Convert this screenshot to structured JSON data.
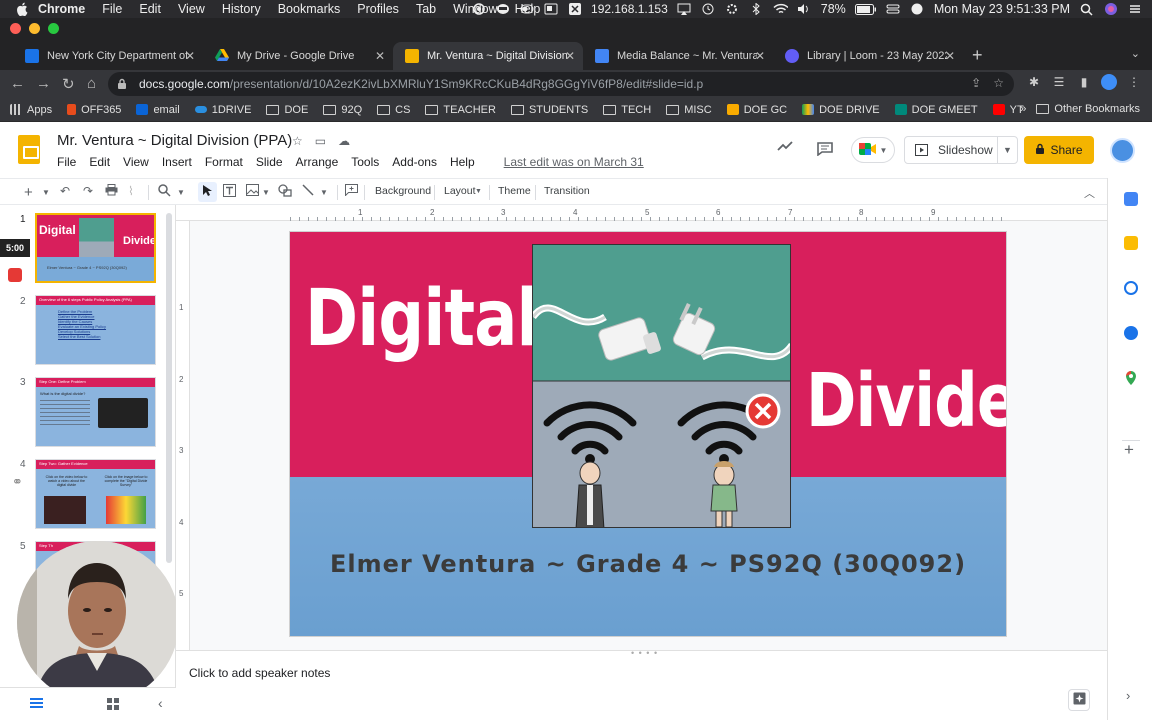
{
  "menubar": {
    "app": "Chrome",
    "items": [
      "File",
      "Edit",
      "View",
      "History",
      "Bookmarks",
      "Profiles",
      "Tab",
      "Window",
      "Help"
    ],
    "ip": "192.168.1.153",
    "battery": "78%",
    "datetime": "Mon May 23  9:51:33 PM"
  },
  "tabs": [
    {
      "label": "New York City Department of E",
      "color": "#1a73e8"
    },
    {
      "label": "My Drive - Google Drive",
      "color": "#34a853"
    },
    {
      "label": "Mr. Ventura ~ Digital Division (",
      "color": "#f4b400"
    },
    {
      "label": "Media Balance ~ Mr. Ventura 3",
      "color": "#4285f4"
    },
    {
      "label": "Library | Loom - 23 May 2022",
      "color": "#625df5"
    }
  ],
  "address": {
    "host": "docs.google.com",
    "path": "/presentation/d/10A2ezK2ivLbXMRluY1Sm9KRcCKuB4dRg8GGgYiV6fP8/edit#slide=id.p"
  },
  "bookmarks": {
    "items": [
      "Apps",
      "OFF365",
      "email",
      "1DRIVE",
      "DOE",
      "92Q",
      "CS",
      "TEACHER",
      "STUDENTS",
      "TECH",
      "MISC",
      "DOE GC",
      "DOE DRIVE",
      "DOE GMEET",
      "YT"
    ],
    "more": "»",
    "other": "Other Bookmarks"
  },
  "doc": {
    "title": "Mr. Ventura ~ Digital Division (PPA)",
    "menus": [
      "File",
      "Edit",
      "View",
      "Insert",
      "Format",
      "Slide",
      "Arrange",
      "Tools",
      "Add-ons",
      "Help"
    ],
    "last_edit": "Last edit was on March 31",
    "slideshow_label": "Slideshow",
    "share_label": "Share"
  },
  "toolbar": {
    "background": "Background",
    "layout": "Layout",
    "theme": "Theme",
    "transition": "Transition"
  },
  "filmstrip": {
    "numbers": [
      "1",
      "2",
      "3",
      "4",
      "5"
    ],
    "timer": "5:00",
    "thumb1": {
      "left": "Digital",
      "right": "Divide",
      "sub": "Elmer Ventura ~ Grade 4 ~ PS92Q (30Q092)"
    },
    "thumb2": {
      "title": "Overview of the 6 steps Public Policy Analysis (PPA)",
      "lines": [
        "Define the Problem",
        "Gather the Evidence",
        "Identify the Causes",
        "Evaluate an Existing Policy",
        "Develop Solutions",
        "Select the Best Solution"
      ]
    },
    "thumb3": {
      "title": "Step One: Define Problem",
      "q": "What is the digital divide?"
    },
    "thumb4": {
      "title": "Step Two: Gather Evidence",
      "a": "Click on the video below to watch a video about the digital divide",
      "b": "Click on the image below to complete the \"Digital Divide Survey\""
    },
    "thumb5": {
      "title": "Step Th"
    }
  },
  "ruler": {
    "h": [
      "1",
      "2",
      "3",
      "4",
      "5",
      "6",
      "7",
      "8",
      "9"
    ],
    "v": [
      "1",
      "2",
      "3",
      "4",
      "5"
    ]
  },
  "slide": {
    "word1": "Digital",
    "word2": "Divide",
    "subtitle": "Elmer Ventura ~ Grade 4 ~ PS92Q (30Q092)",
    "colors": {
      "band": "#d81f5c",
      "bottom": "#7aaad8",
      "panel_top": "#4f9e8f",
      "panel_bottom": "#9eaab8"
    }
  },
  "notes": {
    "placeholder": "Click to add speaker notes"
  }
}
